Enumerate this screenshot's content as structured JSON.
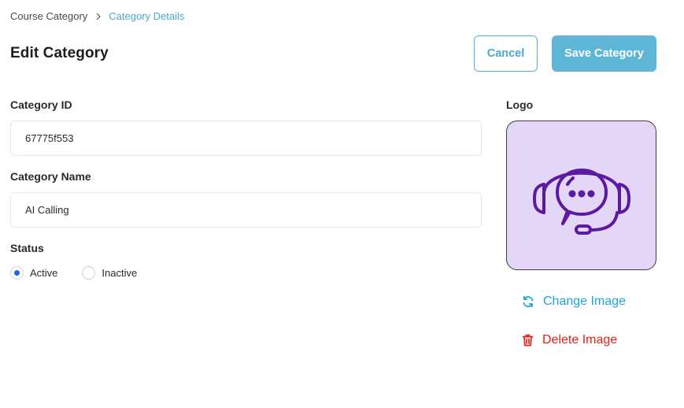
{
  "breadcrumb": {
    "parent": "Course Category",
    "current": "Category Details"
  },
  "header": {
    "title": "Edit Category",
    "cancel_label": "Cancel",
    "save_label": "Save Category"
  },
  "form": {
    "category_id": {
      "label": "Category ID",
      "value": "67775f553"
    },
    "category_name": {
      "label": "Category Name",
      "value": "AI Calling"
    },
    "status": {
      "label": "Status",
      "options": [
        "Active",
        "Inactive"
      ],
      "selected": "Active"
    }
  },
  "logo": {
    "label": "Logo",
    "image_icon": "headset-chat-icon",
    "image_background": "#e4d6f7",
    "icon_color": "#5b1aa0",
    "change_label": "Change Image",
    "delete_label": "Delete Image"
  },
  "colors": {
    "accent": "#4aa8cf",
    "primary_button": "#5db6d6",
    "link": "#1aa6d8",
    "danger": "#e0201b",
    "radio_selected": "#2563d9"
  }
}
